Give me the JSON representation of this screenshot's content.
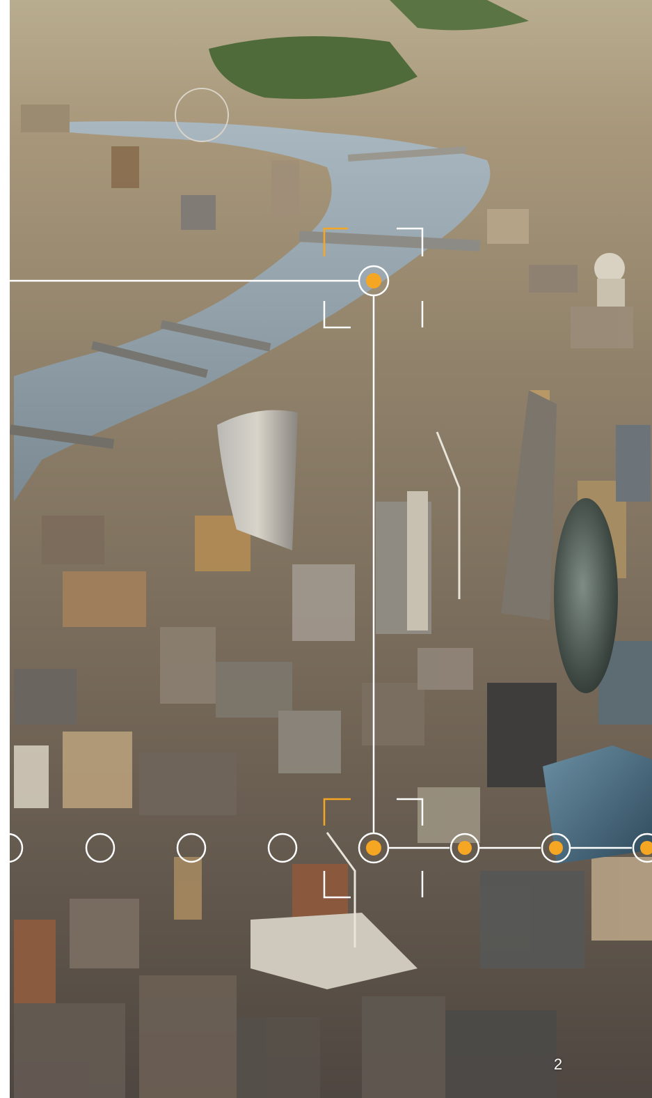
{
  "page": {
    "number": "2"
  },
  "colors": {
    "accent": "#F5A623",
    "overlay_line": "#ffffff"
  },
  "timeline": {
    "nodes": [
      {
        "state": "open"
      },
      {
        "state": "open"
      },
      {
        "state": "open"
      },
      {
        "state": "open"
      },
      {
        "state": "active"
      },
      {
        "state": "filled"
      },
      {
        "state": "filled"
      },
      {
        "state": "filled"
      }
    ]
  }
}
